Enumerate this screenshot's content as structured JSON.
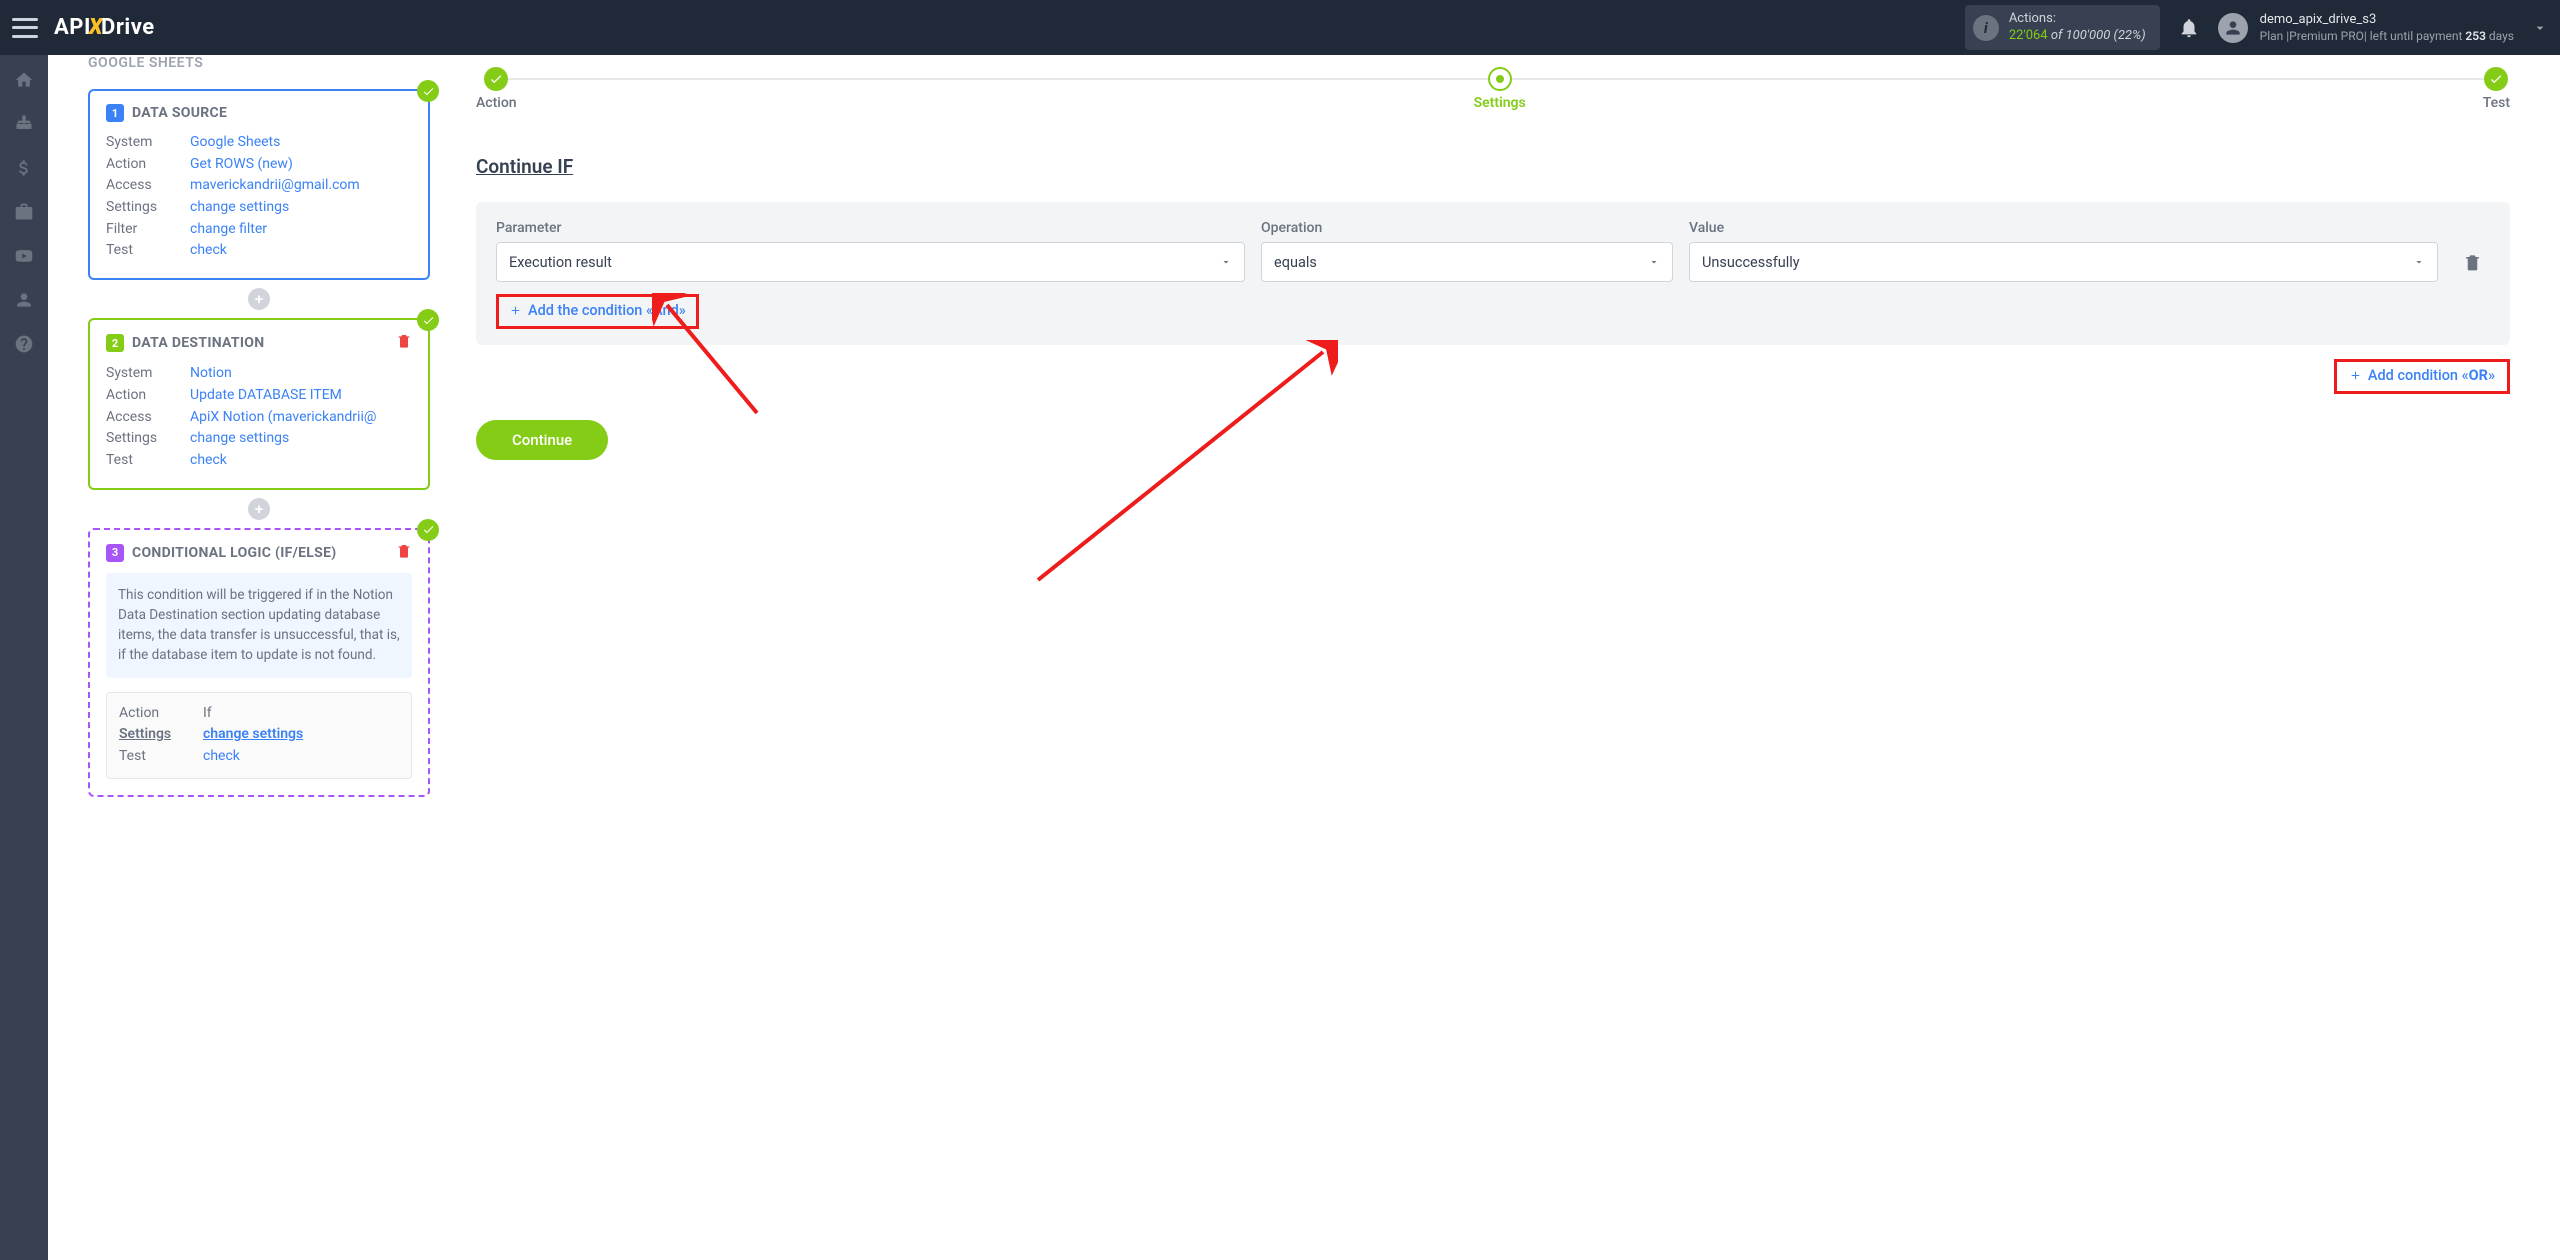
{
  "header": {
    "logo_api": "API",
    "logo_x": "X",
    "logo_drive": "Drive",
    "actions_label": "Actions:",
    "actions_used": "22'064",
    "actions_of": " of ",
    "actions_total": "100'000",
    "actions_pct": " (22%)",
    "user_name": "demo_apix_drive_s3",
    "user_plan_prefix": "Plan |Premium PRO| left until payment ",
    "user_plan_days": "253",
    "user_plan_suffix": " days"
  },
  "left_panel": {
    "section_label": "GOOGLE SHEETS",
    "source": {
      "title": "DATA SOURCE",
      "number": "1",
      "rows": {
        "system_label": "System",
        "system_value": "Google Sheets",
        "action_label": "Action",
        "action_value": "Get ROWS (new)",
        "access_label": "Access",
        "access_value": "maverickandrii@gmail.com",
        "settings_label": "Settings",
        "settings_value": "change settings",
        "filter_label": "Filter",
        "filter_value": "change filter",
        "test_label": "Test",
        "test_value": "check"
      }
    },
    "dest": {
      "title": "DATA DESTINATION",
      "number": "2",
      "rows": {
        "system_label": "System",
        "system_value": "Notion",
        "action_label": "Action",
        "action_value": "Update DATABASE ITEM",
        "access_label": "Access",
        "access_value": "ApiX Notion (maverickandrii@",
        "settings_label": "Settings",
        "settings_value": "change settings",
        "test_label": "Test",
        "test_value": "check"
      }
    },
    "cond": {
      "title": "CONDITIONAL LOGIC (IF/ELSE)",
      "number": "3",
      "info": "This condition will be triggered if in the Notion Data Destination section updating database items, the data transfer is unsuccessful, that is, if the database item to update is not found.",
      "rows": {
        "action_label": "Action",
        "action_value": "If",
        "settings_label": "Settings",
        "settings_value": "change settings",
        "test_label": "Test",
        "test_value": "check"
      }
    }
  },
  "right": {
    "step_action": "Action",
    "step_settings": "Settings",
    "step_test": "Test",
    "cond_title": "Continue IF",
    "labels": {
      "parameter": "Parameter",
      "operation": "Operation",
      "value": "Value"
    },
    "values": {
      "parameter": "Execution result",
      "operation": "equals",
      "value": "Unsuccessfully"
    },
    "add_and": "Add the condition «And»",
    "add_or_prefix": "Add condition «",
    "add_or_bold": "OR",
    "add_or_suffix": "»",
    "continue_btn": "Continue"
  }
}
